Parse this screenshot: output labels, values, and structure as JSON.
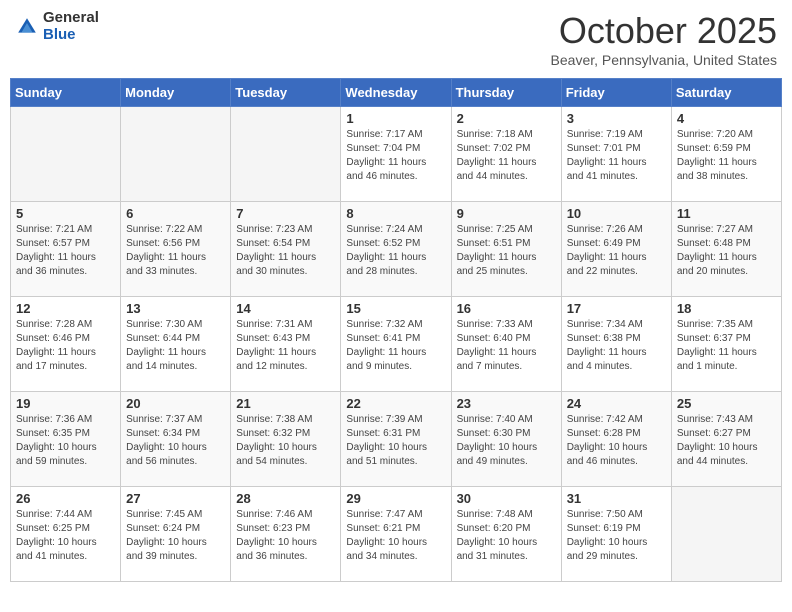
{
  "header": {
    "logo_general": "General",
    "logo_blue": "Blue",
    "month_title": "October 2025",
    "location": "Beaver, Pennsylvania, United States"
  },
  "days_of_week": [
    "Sunday",
    "Monday",
    "Tuesday",
    "Wednesday",
    "Thursday",
    "Friday",
    "Saturday"
  ],
  "weeks": [
    [
      {
        "day": "",
        "info": ""
      },
      {
        "day": "",
        "info": ""
      },
      {
        "day": "",
        "info": ""
      },
      {
        "day": "1",
        "info": "Sunrise: 7:17 AM\nSunset: 7:04 PM\nDaylight: 11 hours and 46 minutes."
      },
      {
        "day": "2",
        "info": "Sunrise: 7:18 AM\nSunset: 7:02 PM\nDaylight: 11 hours and 44 minutes."
      },
      {
        "day": "3",
        "info": "Sunrise: 7:19 AM\nSunset: 7:01 PM\nDaylight: 11 hours and 41 minutes."
      },
      {
        "day": "4",
        "info": "Sunrise: 7:20 AM\nSunset: 6:59 PM\nDaylight: 11 hours and 38 minutes."
      }
    ],
    [
      {
        "day": "5",
        "info": "Sunrise: 7:21 AM\nSunset: 6:57 PM\nDaylight: 11 hours and 36 minutes."
      },
      {
        "day": "6",
        "info": "Sunrise: 7:22 AM\nSunset: 6:56 PM\nDaylight: 11 hours and 33 minutes."
      },
      {
        "day": "7",
        "info": "Sunrise: 7:23 AM\nSunset: 6:54 PM\nDaylight: 11 hours and 30 minutes."
      },
      {
        "day": "8",
        "info": "Sunrise: 7:24 AM\nSunset: 6:52 PM\nDaylight: 11 hours and 28 minutes."
      },
      {
        "day": "9",
        "info": "Sunrise: 7:25 AM\nSunset: 6:51 PM\nDaylight: 11 hours and 25 minutes."
      },
      {
        "day": "10",
        "info": "Sunrise: 7:26 AM\nSunset: 6:49 PM\nDaylight: 11 hours and 22 minutes."
      },
      {
        "day": "11",
        "info": "Sunrise: 7:27 AM\nSunset: 6:48 PM\nDaylight: 11 hours and 20 minutes."
      }
    ],
    [
      {
        "day": "12",
        "info": "Sunrise: 7:28 AM\nSunset: 6:46 PM\nDaylight: 11 hours and 17 minutes."
      },
      {
        "day": "13",
        "info": "Sunrise: 7:30 AM\nSunset: 6:44 PM\nDaylight: 11 hours and 14 minutes."
      },
      {
        "day": "14",
        "info": "Sunrise: 7:31 AM\nSunset: 6:43 PM\nDaylight: 11 hours and 12 minutes."
      },
      {
        "day": "15",
        "info": "Sunrise: 7:32 AM\nSunset: 6:41 PM\nDaylight: 11 hours and 9 minutes."
      },
      {
        "day": "16",
        "info": "Sunrise: 7:33 AM\nSunset: 6:40 PM\nDaylight: 11 hours and 7 minutes."
      },
      {
        "day": "17",
        "info": "Sunrise: 7:34 AM\nSunset: 6:38 PM\nDaylight: 11 hours and 4 minutes."
      },
      {
        "day": "18",
        "info": "Sunrise: 7:35 AM\nSunset: 6:37 PM\nDaylight: 11 hours and 1 minute."
      }
    ],
    [
      {
        "day": "19",
        "info": "Sunrise: 7:36 AM\nSunset: 6:35 PM\nDaylight: 10 hours and 59 minutes."
      },
      {
        "day": "20",
        "info": "Sunrise: 7:37 AM\nSunset: 6:34 PM\nDaylight: 10 hours and 56 minutes."
      },
      {
        "day": "21",
        "info": "Sunrise: 7:38 AM\nSunset: 6:32 PM\nDaylight: 10 hours and 54 minutes."
      },
      {
        "day": "22",
        "info": "Sunrise: 7:39 AM\nSunset: 6:31 PM\nDaylight: 10 hours and 51 minutes."
      },
      {
        "day": "23",
        "info": "Sunrise: 7:40 AM\nSunset: 6:30 PM\nDaylight: 10 hours and 49 minutes."
      },
      {
        "day": "24",
        "info": "Sunrise: 7:42 AM\nSunset: 6:28 PM\nDaylight: 10 hours and 46 minutes."
      },
      {
        "day": "25",
        "info": "Sunrise: 7:43 AM\nSunset: 6:27 PM\nDaylight: 10 hours and 44 minutes."
      }
    ],
    [
      {
        "day": "26",
        "info": "Sunrise: 7:44 AM\nSunset: 6:25 PM\nDaylight: 10 hours and 41 minutes."
      },
      {
        "day": "27",
        "info": "Sunrise: 7:45 AM\nSunset: 6:24 PM\nDaylight: 10 hours and 39 minutes."
      },
      {
        "day": "28",
        "info": "Sunrise: 7:46 AM\nSunset: 6:23 PM\nDaylight: 10 hours and 36 minutes."
      },
      {
        "day": "29",
        "info": "Sunrise: 7:47 AM\nSunset: 6:21 PM\nDaylight: 10 hours and 34 minutes."
      },
      {
        "day": "30",
        "info": "Sunrise: 7:48 AM\nSunset: 6:20 PM\nDaylight: 10 hours and 31 minutes."
      },
      {
        "day": "31",
        "info": "Sunrise: 7:50 AM\nSunset: 6:19 PM\nDaylight: 10 hours and 29 minutes."
      },
      {
        "day": "",
        "info": ""
      }
    ]
  ]
}
